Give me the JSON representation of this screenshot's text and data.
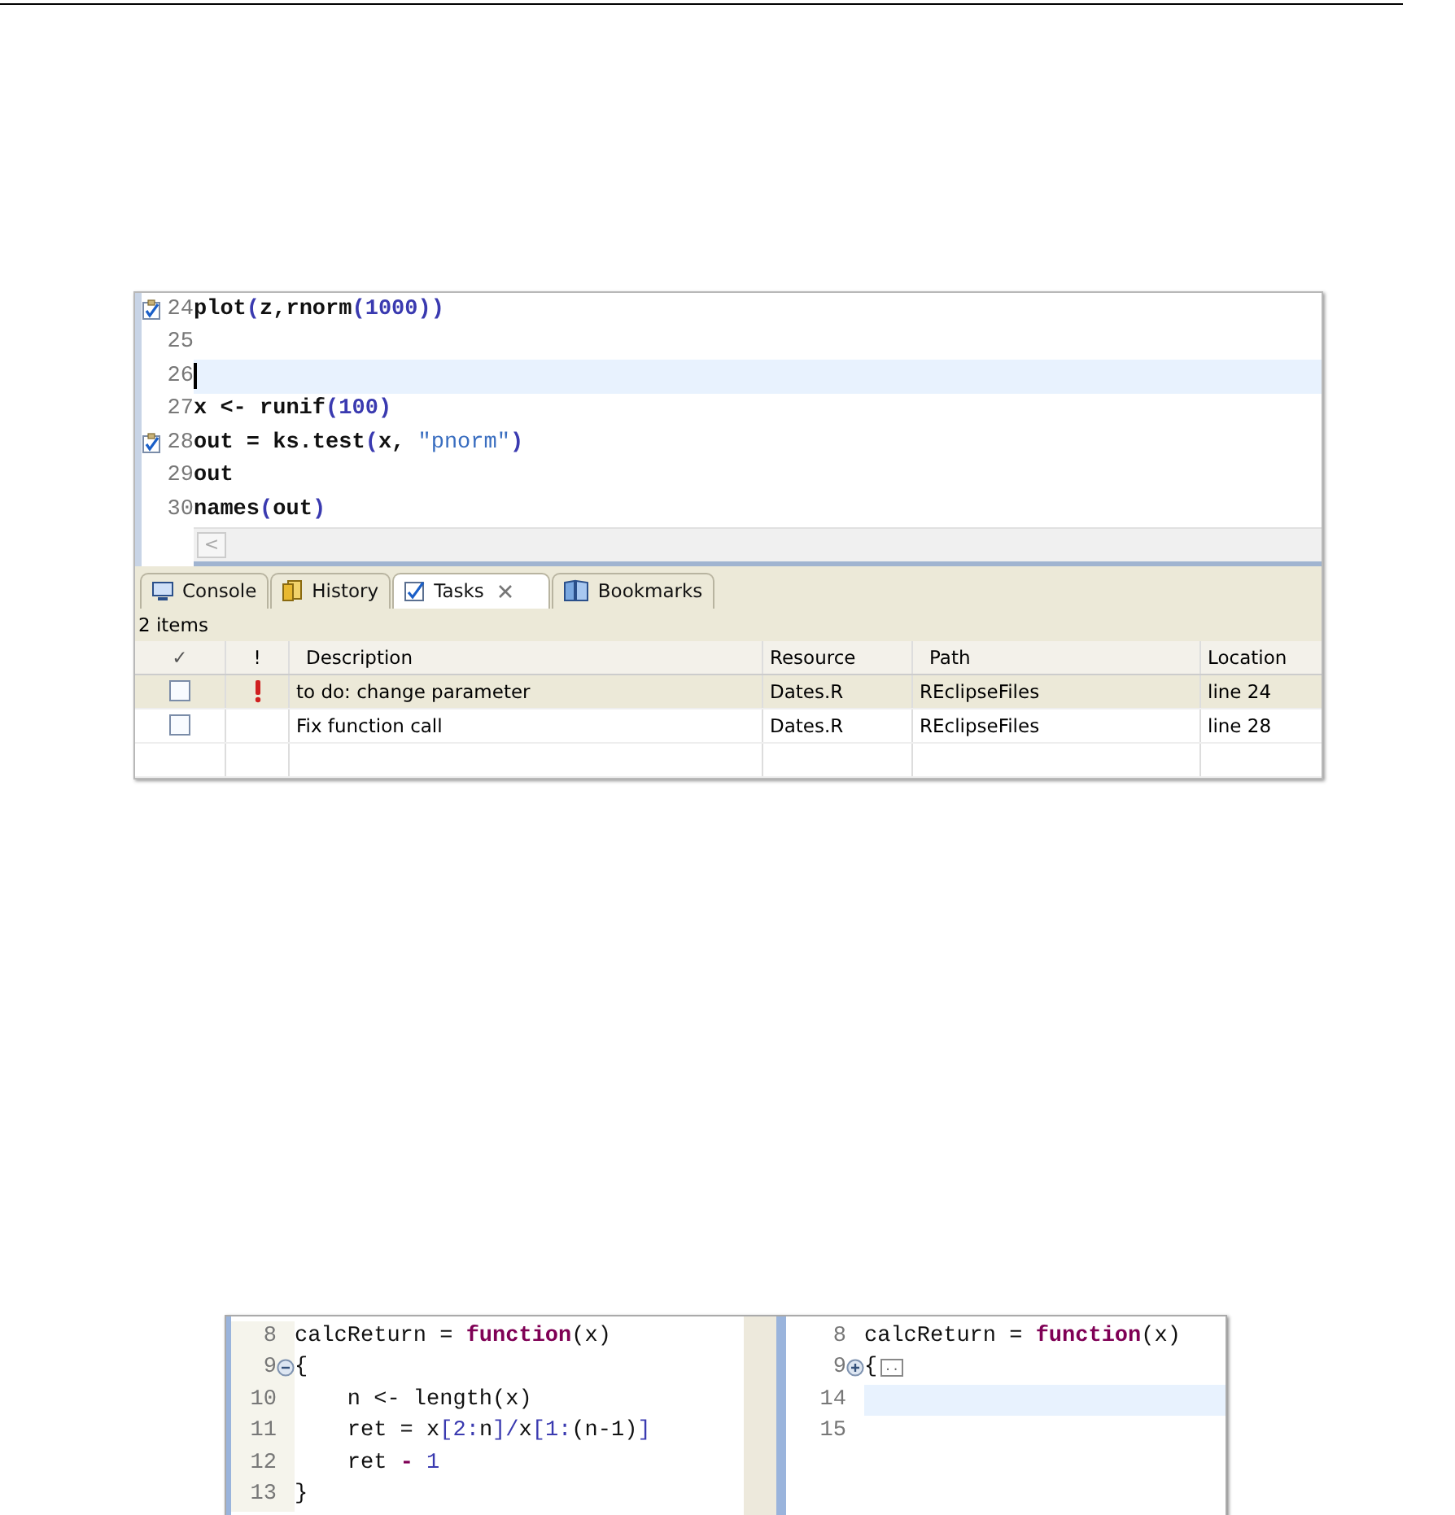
{
  "editor": {
    "lines": [
      {
        "number": "24",
        "task_marker": true,
        "current": false,
        "code": [
          {
            "t": "plot",
            "kind": "text"
          },
          {
            "t": "(",
            "kind": "paren"
          },
          {
            "t": "z,rnorm",
            "kind": "text"
          },
          {
            "t": "(",
            "kind": "paren"
          },
          {
            "t": "1000",
            "kind": "num"
          },
          {
            "t": "))",
            "kind": "paren"
          }
        ]
      },
      {
        "number": "25",
        "task_marker": false,
        "current": false
      },
      {
        "number": "26",
        "task_marker": false,
        "current": true
      },
      {
        "number": "27",
        "task_marker": false,
        "current": false,
        "code": [
          {
            "t": "x <- runif",
            "kind": "text"
          },
          {
            "t": "(",
            "kind": "paren"
          },
          {
            "t": "100",
            "kind": "num"
          },
          {
            "t": ")",
            "kind": "paren"
          }
        ]
      },
      {
        "number": "28",
        "task_marker": true,
        "current": false,
        "code": [
          {
            "t": "out = ks.test",
            "kind": "text"
          },
          {
            "t": "(",
            "kind": "paren"
          },
          {
            "t": "x, ",
            "kind": "text"
          },
          {
            "t": "\"pnorm\"",
            "kind": "str"
          },
          {
            "t": ")",
            "kind": "paren"
          }
        ]
      },
      {
        "number": "29",
        "task_marker": false,
        "current": false,
        "code": [
          {
            "t": "out",
            "kind": "text"
          }
        ]
      },
      {
        "number": "30",
        "task_marker": false,
        "current": false,
        "code": [
          {
            "t": "names",
            "kind": "text"
          },
          {
            "t": "(",
            "kind": "paren"
          },
          {
            "t": "out",
            "kind": "text"
          },
          {
            "t": ")",
            "kind": "paren"
          }
        ]
      }
    ],
    "scroll_arrow": "<"
  },
  "tabs": [
    {
      "label": "Console",
      "kind": "console",
      "selected": false,
      "closable": false
    },
    {
      "label": "History",
      "kind": "history",
      "selected": false,
      "closable": false
    },
    {
      "label": "Tasks",
      "kind": "tasks",
      "selected": true,
      "closable": true
    },
    {
      "label": "Bookmarks",
      "kind": "bookmarks",
      "selected": false,
      "closable": false
    }
  ],
  "tasks": {
    "count": "2 items",
    "columns": [
      "✓",
      "!",
      "Description",
      "Resource",
      "Path",
      "Location"
    ],
    "rows": [
      {
        "checked": false,
        "high_priority": true,
        "selected": true,
        "description": "to do: change parameter",
        "resource": "Dates.R",
        "path": "REclipseFiles",
        "location": "line 24"
      },
      {
        "checked": false,
        "high_priority": false,
        "selected": false,
        "description": "Fix function call",
        "resource": "Dates.R",
        "path": "REclipseFiles",
        "location": "line 28"
      }
    ]
  },
  "fold_left": {
    "lines": [
      {
        "number": "8",
        "kind": "plain",
        "current": false,
        "code": [
          {
            "t": "calcReturn = ",
            "kind": "text"
          },
          {
            "t": "function",
            "kind": "kw"
          },
          {
            "t": "(x)",
            "kind": "text"
          }
        ]
      },
      {
        "number": "9",
        "kind": "fold_open",
        "current": false,
        "code": [
          {
            "t": "{",
            "kind": "text"
          }
        ]
      },
      {
        "number": "10",
        "kind": "plain",
        "current": false,
        "code": [
          {
            "t": "    n <- length(x)",
            "kind": "text"
          }
        ]
      },
      {
        "number": "11",
        "kind": "plain",
        "current": false,
        "code": [
          {
            "t": "    ret = x",
            "kind": "text"
          },
          {
            "t": "[2:",
            "kind": "paren"
          },
          {
            "t": "n",
            "kind": "text"
          },
          {
            "t": "]/",
            "kind": "paren"
          },
          {
            "t": "x",
            "kind": "text"
          },
          {
            "t": "[1:",
            "kind": "paren"
          },
          {
            "t": "(n-1)",
            "kind": "text"
          },
          {
            "t": "]",
            "kind": "paren"
          }
        ]
      },
      {
        "number": "12",
        "kind": "plain",
        "current": false,
        "code": [
          {
            "t": "    ret ",
            "kind": "text"
          },
          {
            "t": "-",
            "kind": "kw"
          },
          {
            "t": " 1",
            "kind": "num"
          }
        ]
      },
      {
        "number": "13",
        "kind": "plain",
        "current": false,
        "code": [
          {
            "t": "}",
            "kind": "text"
          }
        ]
      }
    ]
  },
  "fold_right": {
    "lines": [
      {
        "number": "8",
        "kind": "plain",
        "current": false,
        "code": [
          {
            "t": "calcReturn = ",
            "kind": "text"
          },
          {
            "t": "function",
            "kind": "kw"
          },
          {
            "t": "(x)",
            "kind": "text"
          }
        ]
      },
      {
        "number": "9",
        "kind": "fold_closed",
        "current": false,
        "code": [
          {
            "t": "{",
            "kind": "text"
          },
          {
            "t": "..",
            "kind": "folded"
          }
        ]
      },
      {
        "number": "14",
        "kind": "plain",
        "current": true
      },
      {
        "number": "15",
        "kind": "plain",
        "current": false
      }
    ]
  }
}
